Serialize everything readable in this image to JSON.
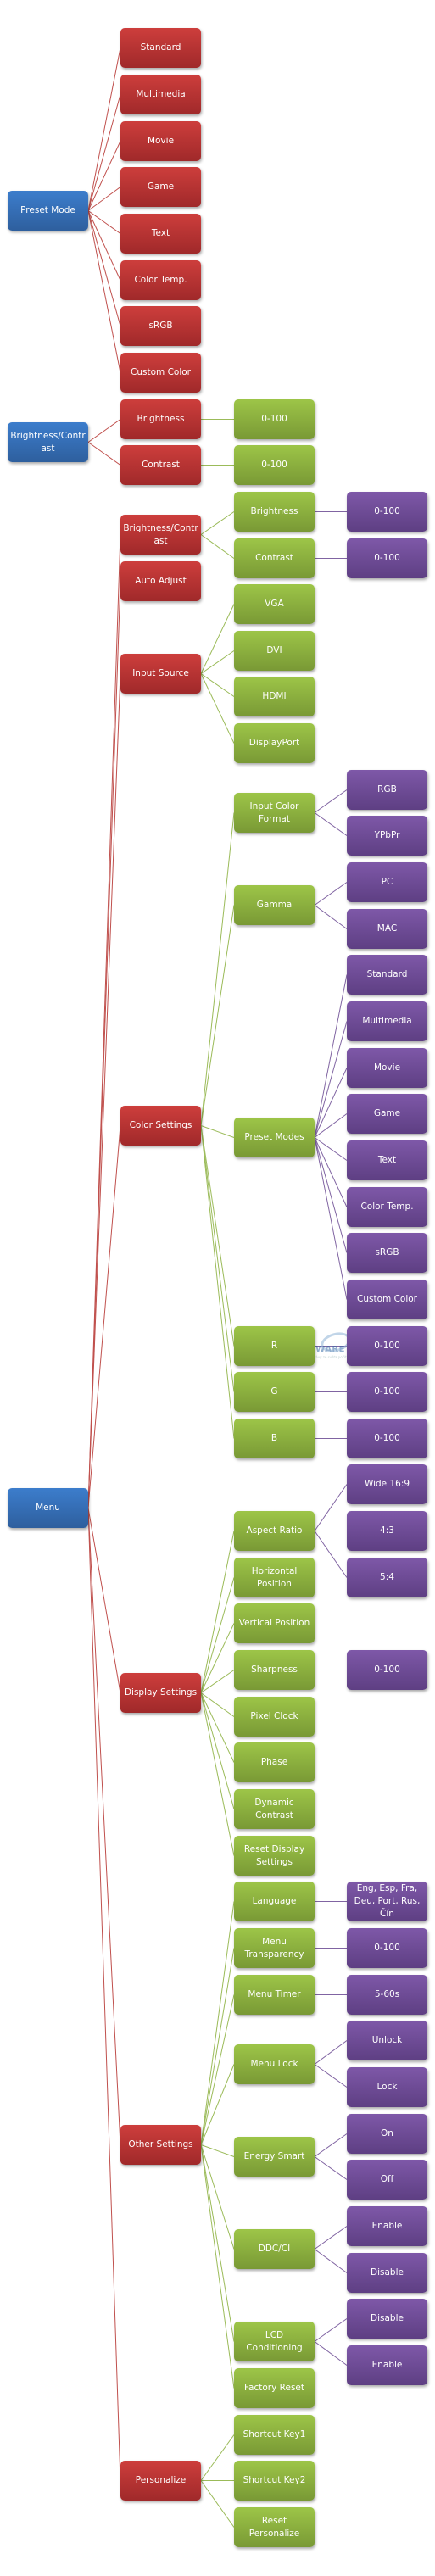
{
  "colors": {
    "level0": "#3c7dcc",
    "level1": "#cd3e3c",
    "level2": "#9dc548",
    "level3": "#7e58a8",
    "link_level1": "#c0504d",
    "link_level2": "#9bbb59",
    "link_level3": "#8064a2"
  },
  "watermark": {
    "line1": "SVĚT",
    "line2": "HARDWARE",
    "sub": "zprávy ze světa počítačů"
  },
  "trees": [
    {
      "label": "Preset Mode",
      "children": [
        {
          "label": "Standard"
        },
        {
          "label": "Multimedia"
        },
        {
          "label": "Movie"
        },
        {
          "label": "Game"
        },
        {
          "label": "Text"
        },
        {
          "label": "Color Temp."
        },
        {
          "label": "sRGB"
        },
        {
          "label": "Custom Color"
        }
      ]
    },
    {
      "label": "Brightness/Contrast",
      "children": [
        {
          "label": "Brightness",
          "children": [
            {
              "label": "0-100"
            }
          ]
        },
        {
          "label": "Contrast",
          "children": [
            {
              "label": "0-100"
            }
          ]
        }
      ]
    },
    {
      "label": "Menu",
      "children": [
        {
          "label": "Brightness/Contrast",
          "children": [
            {
              "label": "Brightness",
              "children": [
                {
                  "label": "0-100"
                }
              ]
            },
            {
              "label": "Contrast",
              "children": [
                {
                  "label": "0-100"
                }
              ]
            }
          ]
        },
        {
          "label": "Auto Adjust"
        },
        {
          "label": "Input Source",
          "children": [
            {
              "label": "VGA"
            },
            {
              "label": "DVI"
            },
            {
              "label": "HDMI"
            },
            {
              "label": "DisplayPort"
            }
          ]
        },
        {
          "label": "Color Settings",
          "children": [
            {
              "label": "Input Color Format",
              "children": [
                {
                  "label": "RGB"
                },
                {
                  "label": "YPbPr"
                }
              ]
            },
            {
              "label": "Gamma",
              "children": [
                {
                  "label": "PC"
                },
                {
                  "label": "MAC"
                }
              ]
            },
            {
              "label": "Preset Modes",
              "children": [
                {
                  "label": "Standard"
                },
                {
                  "label": "Multimedia"
                },
                {
                  "label": "Movie"
                },
                {
                  "label": "Game"
                },
                {
                  "label": "Text"
                },
                {
                  "label": "Color Temp."
                },
                {
                  "label": "sRGB"
                },
                {
                  "label": "Custom Color"
                }
              ]
            },
            {
              "label": "R",
              "children": [
                {
                  "label": "0-100"
                }
              ]
            },
            {
              "label": "G",
              "children": [
                {
                  "label": "0-100"
                }
              ]
            },
            {
              "label": "B",
              "children": [
                {
                  "label": "0-100"
                }
              ]
            }
          ]
        },
        {
          "label": "Display Settings",
          "children": [
            {
              "label": "Aspect Ratio",
              "children": [
                {
                  "label": "Wide 16:9"
                },
                {
                  "label": "4:3"
                },
                {
                  "label": "5:4"
                }
              ]
            },
            {
              "label": "Horizontal Position"
            },
            {
              "label": "Vertical Position"
            },
            {
              "label": "Sharpness",
              "children": [
                {
                  "label": "0-100"
                }
              ]
            },
            {
              "label": "Pixel Clock"
            },
            {
              "label": "Phase"
            },
            {
              "label": "Dynamic Contrast"
            },
            {
              "label": "Reset Display Settings"
            }
          ]
        },
        {
          "label": "Other Settings",
          "children": [
            {
              "label": "Language",
              "children": [
                {
                  "label": "Eng, Esp, Fra, Deu, Port, Rus, Čín"
                }
              ]
            },
            {
              "label": "Menu Transparency",
              "children": [
                {
                  "label": "0-100"
                }
              ]
            },
            {
              "label": "Menu Timer",
              "children": [
                {
                  "label": "5-60s"
                }
              ]
            },
            {
              "label": "Menu Lock",
              "children": [
                {
                  "label": "Unlock"
                },
                {
                  "label": "Lock"
                }
              ]
            },
            {
              "label": "Energy Smart",
              "children": [
                {
                  "label": "On"
                },
                {
                  "label": "Off"
                }
              ]
            },
            {
              "label": "DDC/CI",
              "children": [
                {
                  "label": "Enable"
                },
                {
                  "label": "Disable"
                }
              ]
            },
            {
              "label": "LCD Conditioning",
              "children": [
                {
                  "label": "Disable"
                },
                {
                  "label": "Enable"
                }
              ]
            },
            {
              "label": "Factory Reset"
            }
          ]
        },
        {
          "label": "Personalize",
          "children": [
            {
              "label": "Shortcut Key1"
            },
            {
              "label": "Shortcut Key2"
            },
            {
              "label": "Reset Personalize"
            }
          ]
        }
      ]
    }
  ]
}
